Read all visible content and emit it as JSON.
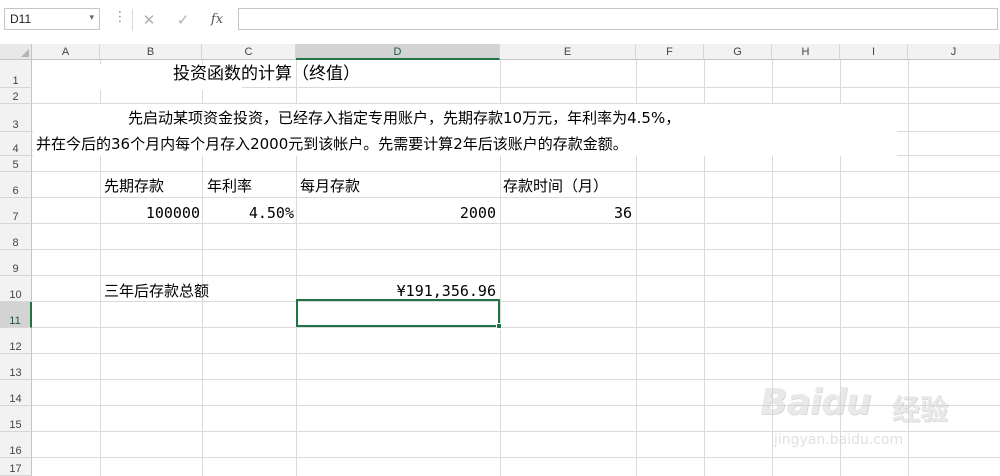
{
  "formula_bar": {
    "name_box": "D11",
    "dropdown_icon": "▾",
    "more_icon": "⋮",
    "cancel_icon": "✕",
    "enter_icon": "✓",
    "fx_label": "fx",
    "formula": ""
  },
  "grid": {
    "columns": [
      "A",
      "B",
      "C",
      "D",
      "E",
      "F",
      "G",
      "H",
      "I",
      "J"
    ],
    "selected_column": "D",
    "rows": [
      "1",
      "2",
      "3",
      "4",
      "5",
      "6",
      "7",
      "8",
      "9",
      "10",
      "11",
      "12",
      "13",
      "14",
      "15",
      "16",
      "17"
    ],
    "selected_row": "11",
    "accent_color": "#217346",
    "active_cell": "D11"
  },
  "cells": {
    "title": "投资函数的计算（终值）",
    "para_line1": "先启动某项资金投资，已经存入指定专用账户，先期存款10万元，年利率为4.5%，",
    "para_line2": "并在今后的36个月内每个月存入2000元到该帐户。先需要计算2年后该账户的存款金额。",
    "b6": "先期存款",
    "c6": "年利率",
    "d6": "每月存款",
    "e6": "存款时间（月）",
    "b7": "100000",
    "c7": "4.50%",
    "d7": "2000",
    "e7": "36",
    "b10": "三年后存款总额",
    "d10": "¥191,356.96"
  },
  "watermark": {
    "logo": "Baidu",
    "logo_cn": "经验",
    "url": "jingyan.baidu.com"
  }
}
